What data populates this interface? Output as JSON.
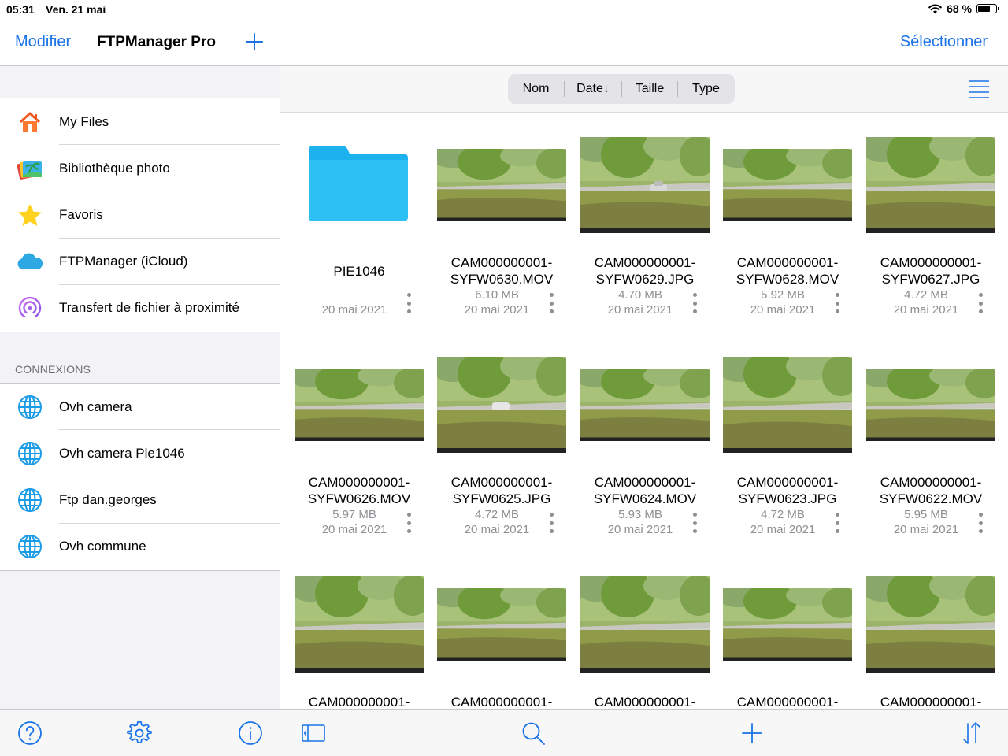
{
  "status_bar": {
    "time": "05:31",
    "date": "Ven. 21 mai",
    "battery": "68 %",
    "battery_level": 0.68
  },
  "sidebar": {
    "edit_label": "Modifier",
    "title": "FTPManager Pro",
    "items": [
      {
        "label": "My Files",
        "icon": "house-icon"
      },
      {
        "label": "Bibliothèque photo",
        "icon": "photos-icon"
      },
      {
        "label": "Favoris",
        "icon": "star-icon"
      },
      {
        "label": "FTPManager (iCloud)",
        "icon": "cloud-icon"
      },
      {
        "label": "Transfert de fichier à proximité",
        "icon": "airdrop-icon"
      }
    ],
    "connections_header": "CONNEXIONS",
    "connections": [
      {
        "label": "Ovh camera"
      },
      {
        "label": "Ovh camera Ple1046"
      },
      {
        "label": "Ftp dan.georges"
      },
      {
        "label": "Ovh commune"
      }
    ]
  },
  "main": {
    "select_label": "Sélectionner",
    "sort": [
      "Nom",
      "Date↓",
      "Taille",
      "Type"
    ],
    "files": [
      {
        "name": "PIE1046",
        "size": "",
        "date": "20 mai 2021",
        "kind": "folder"
      },
      {
        "name": "CAM000000001-SYFW0630.MOV",
        "size": "6.10 MB",
        "date": "20 mai 2021",
        "kind": "media"
      },
      {
        "name": "CAM000000001-SYFW0629.JPG",
        "size": "4.70 MB",
        "date": "20 mai 2021",
        "kind": "media"
      },
      {
        "name": "CAM000000001-SYFW0628.MOV",
        "size": "5.92 MB",
        "date": "20 mai 2021",
        "kind": "media"
      },
      {
        "name": "CAM000000001-SYFW0627.JPG",
        "size": "4.72 MB",
        "date": "20 mai 2021",
        "kind": "media"
      },
      {
        "name": "CAM000000001-SYFW0626.MOV",
        "size": "5.97 MB",
        "date": "20 mai 2021",
        "kind": "media"
      },
      {
        "name": "CAM000000001-SYFW0625.JPG",
        "size": "4.72 MB",
        "date": "20 mai 2021",
        "kind": "media"
      },
      {
        "name": "CAM000000001-SYFW0624.MOV",
        "size": "5.93 MB",
        "date": "20 mai 2021",
        "kind": "media"
      },
      {
        "name": "CAM000000001-SYFW0623.JPG",
        "size": "4.72 MB",
        "date": "20 mai 2021",
        "kind": "media"
      },
      {
        "name": "CAM000000001-SYFW0622.MOV",
        "size": "5.95 MB",
        "date": "20 mai 2021",
        "kind": "media"
      },
      {
        "name": "CAM000000001-",
        "size": "",
        "date": "",
        "kind": "media"
      },
      {
        "name": "CAM000000001-",
        "size": "",
        "date": "",
        "kind": "media"
      },
      {
        "name": "CAM000000001-",
        "size": "",
        "date": "",
        "kind": "media"
      },
      {
        "name": "CAM000000001-",
        "size": "",
        "date": "",
        "kind": "media"
      },
      {
        "name": "CAM000000001-",
        "size": "",
        "date": "",
        "kind": "media"
      }
    ]
  },
  "colors": {
    "accent": "#1a73e8",
    "folder": "#25b9f0",
    "icon_blue": "#1c9be6"
  }
}
